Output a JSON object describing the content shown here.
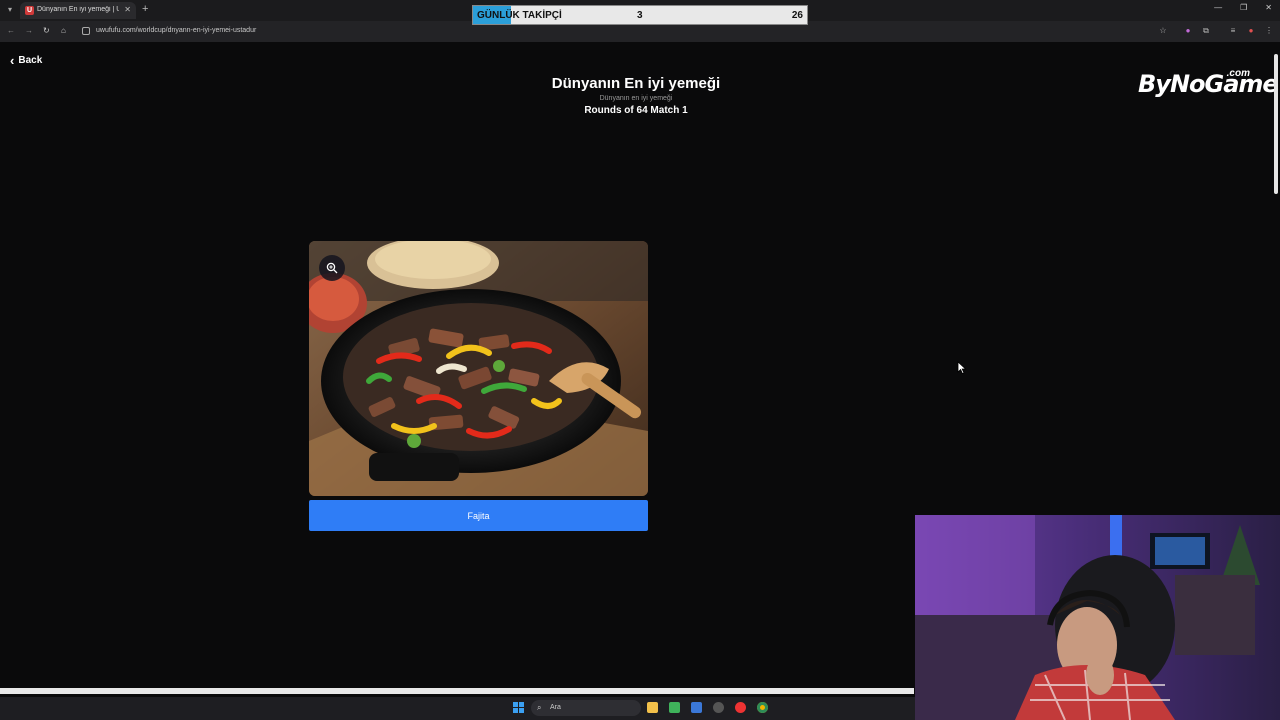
{
  "browser": {
    "tab_title": "Dünyanın En iyi yemeği | UwUF...",
    "favicon_letter": "U",
    "url": "uwufufu.com/worldcup/dnyann-en-iyi-yemei-ustadur"
  },
  "overlay": {
    "label": "GÜNLÜK TAKİPÇİ",
    "current": "3",
    "goal": "26"
  },
  "page": {
    "back_label": "Back",
    "title": "Dünyanın En iyi yemeği",
    "subtitle": "Dünyanın en iyi yemeği",
    "round_info": "Rounds of 64 Match 1"
  },
  "brand": {
    "name": "ByNoGame",
    "suffix": ".com"
  },
  "choice": {
    "label": "Fajita"
  },
  "taskbar": {
    "search_placeholder": "Ara"
  },
  "colors": {
    "choice_button": "#2f7df6",
    "overlay_accent": "#2b9fd9"
  },
  "icons": [
    "tab-list-icon",
    "close-icon",
    "plus-icon",
    "back-icon",
    "forward-icon",
    "reload-icon",
    "home-icon",
    "star-icon",
    "zoom-in-icon",
    "chevron-left-icon",
    "windows-start-icon",
    "search-icon"
  ]
}
